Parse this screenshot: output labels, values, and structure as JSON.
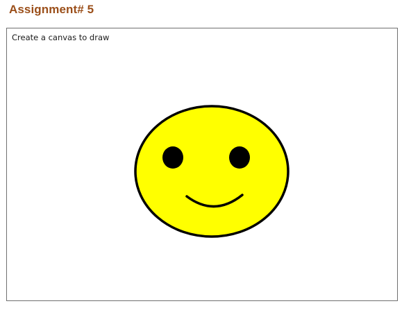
{
  "heading": {
    "text": "Assignment# 5",
    "color": "#9b4f1a"
  },
  "canvas_panel": {
    "caption": "Create a canvas to draw"
  },
  "drawing": {
    "subject": "smiley-face",
    "face_fill": "#ffff00",
    "outline_color": "#000000",
    "eye_color": "#000000"
  }
}
